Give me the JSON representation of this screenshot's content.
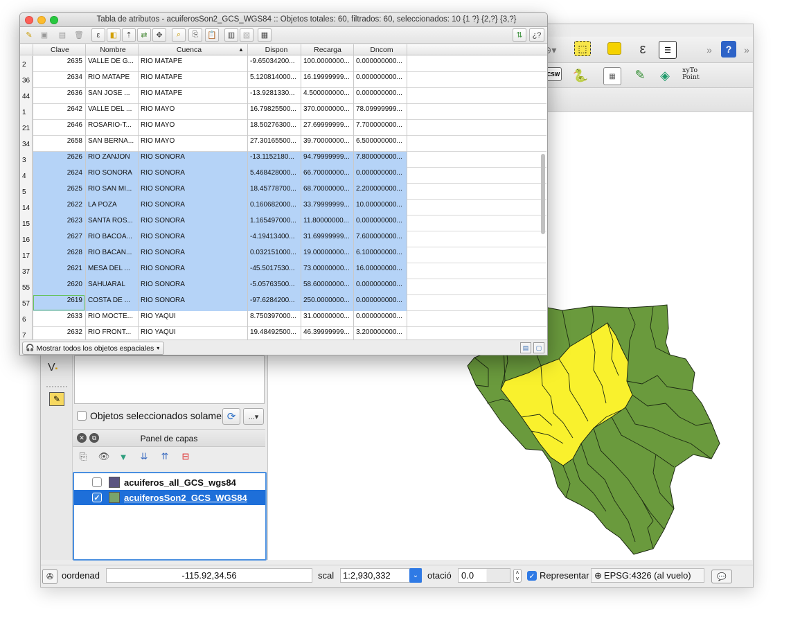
{
  "attr_table": {
    "title": "Tabla de atributos - acuiferosSon2_GCS_WGS84 :: Objetos totales: 60, filtrados: 60, seleccionados: 10 {1 ?} {2,?} {3,?}",
    "columns": [
      "Clave",
      "Nombre",
      "Cuenca",
      "Dispon",
      "Recarga",
      "Dncom"
    ],
    "sort_indicator": "▲",
    "help_label": "¿?",
    "rows": [
      {
        "id": "2",
        "clave": "2635",
        "nombre": "VALLE DE G...",
        "cuenca": "RIO MATAPE",
        "dispon": "-9.65034200...",
        "recarga": "100.0000000...",
        "dncom": "0.000000000...",
        "selected": false
      },
      {
        "id": "36",
        "clave": "2634",
        "nombre": "RIO MATAPE",
        "cuenca": "RIO MATAPE",
        "dispon": "5.120814000...",
        "recarga": "16.19999999...",
        "dncom": "0.000000000...",
        "selected": false
      },
      {
        "id": "44",
        "clave": "2636",
        "nombre": "SAN JOSE ...",
        "cuenca": "RIO MATAPE",
        "dispon": "-13.9281330...",
        "recarga": "4.500000000...",
        "dncom": "0.000000000...",
        "selected": false
      },
      {
        "id": "1",
        "clave": "2642",
        "nombre": "VALLE DEL ...",
        "cuenca": "RIO MAYO",
        "dispon": "16.79825500...",
        "recarga": "370.0000000...",
        "dncom": "78.09999999...",
        "selected": false
      },
      {
        "id": "21",
        "clave": "2646",
        "nombre": "ROSARIO-T...",
        "cuenca": "RIO MAYO",
        "dispon": "18.50276300...",
        "recarga": "27.69999999...",
        "dncom": "7.700000000...",
        "selected": false
      },
      {
        "id": "34",
        "clave": "2658",
        "nombre": "SAN BERNA...",
        "cuenca": "RIO MAYO",
        "dispon": "27.30165500...",
        "recarga": "39.70000000...",
        "dncom": "6.500000000...",
        "selected": false
      },
      {
        "id": "3",
        "clave": "2626",
        "nombre": "RIO ZANJON",
        "cuenca": "RIO SONORA",
        "dispon": "-13.1152180...",
        "recarga": "94.79999999...",
        "dncom": "7.800000000...",
        "selected": true
      },
      {
        "id": "4",
        "clave": "2624",
        "nombre": "RIO SONORA",
        "cuenca": "RIO SONORA",
        "dispon": "5.468428000...",
        "recarga": "66.70000000...",
        "dncom": "0.000000000...",
        "selected": true
      },
      {
        "id": "5",
        "clave": "2625",
        "nombre": "RIO SAN MI...",
        "cuenca": "RIO SONORA",
        "dispon": "18.45778700...",
        "recarga": "68.70000000...",
        "dncom": "2.200000000...",
        "selected": true
      },
      {
        "id": "14",
        "clave": "2622",
        "nombre": "LA POZA",
        "cuenca": "RIO SONORA",
        "dispon": "0.160682000...",
        "recarga": "33.79999999...",
        "dncom": "10.00000000...",
        "selected": true
      },
      {
        "id": "15",
        "clave": "2623",
        "nombre": "SANTA ROS...",
        "cuenca": "RIO SONORA",
        "dispon": "1.165497000...",
        "recarga": "11.80000000...",
        "dncom": "0.000000000...",
        "selected": true
      },
      {
        "id": "16",
        "clave": "2627",
        "nombre": "RIO BACOA...",
        "cuenca": "RIO SONORA",
        "dispon": "-4.19413400...",
        "recarga": "31.69999999...",
        "dncom": "7.600000000...",
        "selected": true
      },
      {
        "id": "17",
        "clave": "2628",
        "nombre": "RIO BACAN...",
        "cuenca": "RIO SONORA",
        "dispon": "0.032151000...",
        "recarga": "19.00000000...",
        "dncom": "6.100000000...",
        "selected": true
      },
      {
        "id": "37",
        "clave": "2621",
        "nombre": "MESA DEL ...",
        "cuenca": "RIO SONORA",
        "dispon": "-45.5017530...",
        "recarga": "73.00000000...",
        "dncom": "16.00000000...",
        "selected": true
      },
      {
        "id": "55",
        "clave": "2620",
        "nombre": "SAHUARAL",
        "cuenca": "RIO SONORA",
        "dispon": "-5.05763500...",
        "recarga": "58.60000000...",
        "dncom": "0.000000000...",
        "selected": true
      },
      {
        "id": "57",
        "clave": "2619",
        "nombre": "COSTA DE ...",
        "cuenca": "RIO SONORA",
        "dispon": "-97.6284200...",
        "recarga": "250.0000000...",
        "dncom": "0.000000000...",
        "selected": true
      },
      {
        "id": "6",
        "clave": "2633",
        "nombre": "RIO MOCTE...",
        "cuenca": "RIO YAQUI",
        "dispon": "8.750397000...",
        "recarga": "31.00000000...",
        "dncom": "0.000000000...",
        "selected": false
      },
      {
        "id": "7",
        "clave": "2632",
        "nombre": "RIO FRONT...",
        "cuenca": "RIO YAQUI",
        "dispon": "19.48492500...",
        "recarga": "46.39999999...",
        "dncom": "3.200000000...",
        "selected": false
      }
    ],
    "show_all_label": "Mostrar todos los objetos espaciales"
  },
  "filter_panel": {
    "selected_only_label": "Objetos seleccionados solamente",
    "more_label": "...▾"
  },
  "layers_panel": {
    "title": "Panel de capas",
    "layers": [
      {
        "name": "acuiferos_all_GCS_wgs84",
        "checked": false,
        "color": "#5b5480",
        "selected": false
      },
      {
        "name": "acuiferosSon2_GCS_WGS84",
        "checked": true,
        "color": "#7aa36a",
        "selected": true
      }
    ]
  },
  "toolbar_misc": {
    "xytopoint_label": "xyTo\nPoint",
    "csw_label": "CSW",
    "overflow_label": "»"
  },
  "status_bar": {
    "coord_label": "oordenad",
    "coord_value": "-115.92,34.56",
    "scale_label": "scal",
    "scale_value": "1:2,930,332",
    "rotation_label": "otació",
    "rotation_value": "0.0",
    "render_label": "Representar",
    "crs_label": "EPSG:4326 (al vuelo)"
  },
  "colors": {
    "selection_blue": "#b5d3f7",
    "map_green": "#6a9a3d",
    "map_yellow": "#f9f12d"
  }
}
